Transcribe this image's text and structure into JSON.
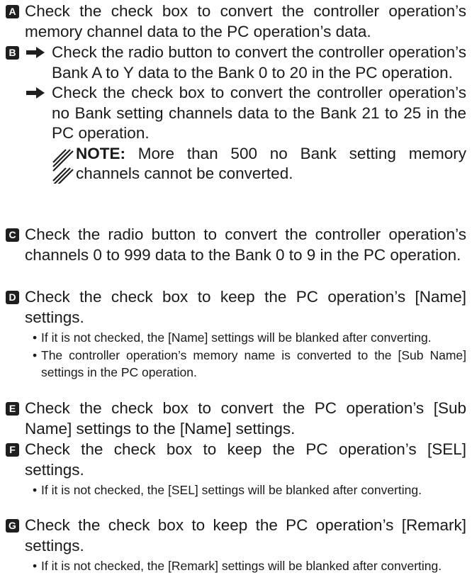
{
  "items": {
    "A": {
      "badge": "A",
      "text": "Check the check box to convert the controller operation’s memory channel data to the PC operation’s data."
    },
    "B": {
      "badge": "B",
      "sub1": "Check the radio button to convert the controller operation’s Bank A to Y data to the Bank 0 to 20 in the PC operation.",
      "sub2": "Check the check box to convert the controller operation’s no Bank setting channels data to the Bank 21 to 25 in the PC operation.",
      "note_label": "NOTE:",
      "note_text": " More than 500 no Bank setting memory channels cannot be converted."
    },
    "C": {
      "badge": "C",
      "text": "Check the radio button to convert the controller operation’s channels 0 to 999 data to the Bank 0 to 9 in the PC operation."
    },
    "D": {
      "badge": "D",
      "text": "Check the check box to keep the PC operation’s [Name] settings.",
      "bullets": [
        "If it is not checked, the [Name] settings will be blanked after converting.",
        "The controller operation’s memory name is converted to the [Sub Name] settings in the PC operation."
      ]
    },
    "E": {
      "badge": "E",
      "text": "Check the check box to convert the PC operation’s [Sub Name] settings to the [Name] settings."
    },
    "F": {
      "badge": "F",
      "text": "Check the check box to keep the PC operation’s [SEL] settings.",
      "bullets": [
        "If it is not checked, the [SEL] settings will be blanked after converting."
      ]
    },
    "G": {
      "badge": "G",
      "text": "Check the check box to keep the PC operation’s [Remark] settings.",
      "bullets": [
        "If it is not checked, the [Remark] settings will be blanked after converting."
      ]
    }
  },
  "bullet_symbol": "•",
  "icons": {
    "arrow": "right-arrow-icon",
    "note": "note-hatch-icon"
  }
}
